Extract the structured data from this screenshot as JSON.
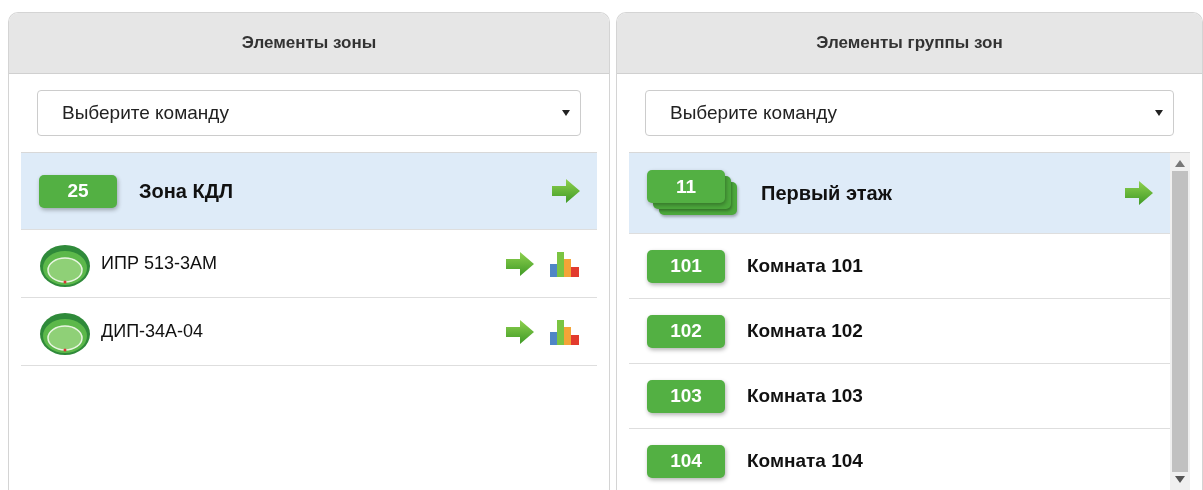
{
  "panels": [
    {
      "title": "Элементы зоны",
      "command": {
        "value": "Выберите команду"
      },
      "scrollbar": false,
      "items": [
        {
          "kind": "zone",
          "number": "25",
          "name": "Зона КДЛ",
          "selected": true
        },
        {
          "kind": "device",
          "name": "ИПР 513-3АМ",
          "selected": false
        },
        {
          "kind": "device",
          "name": "ДИП-34А-04",
          "selected": false
        }
      ]
    },
    {
      "title": "Элементы группы зон",
      "command": {
        "value": "Выберите команду"
      },
      "scrollbar": true,
      "items": [
        {
          "kind": "group",
          "number": "11",
          "name": "Первый этаж",
          "selected": true
        },
        {
          "kind": "room",
          "number": "101",
          "name": "Комната 101",
          "selected": false
        },
        {
          "kind": "room",
          "number": "102",
          "name": "Комната 102",
          "selected": false
        },
        {
          "kind": "room",
          "number": "103",
          "name": "Комната 103",
          "selected": false
        },
        {
          "kind": "room",
          "number": "104",
          "name": "Комната 104",
          "selected": false
        }
      ]
    }
  ]
}
